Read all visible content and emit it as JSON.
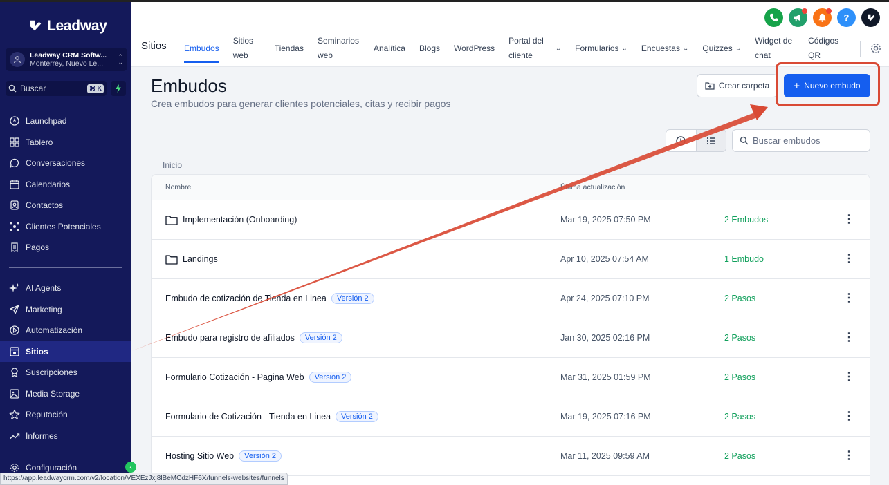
{
  "brand": {
    "name": "Leadway"
  },
  "account": {
    "name": "Leadway CRM Softw...",
    "location": "Monterrey, Nuevo Le..."
  },
  "sidebar": {
    "search_label": "Buscar",
    "search_shortcut": "⌘ K",
    "items": [
      {
        "label": "Launchpad",
        "icon": "rocket-icon"
      },
      {
        "label": "Tablero",
        "icon": "grid-icon"
      },
      {
        "label": "Conversaciones",
        "icon": "chat-icon"
      },
      {
        "label": "Calendarios",
        "icon": "calendar-icon"
      },
      {
        "label": "Contactos",
        "icon": "contacts-icon"
      },
      {
        "label": "Clientes Potenciales",
        "icon": "leads-icon"
      },
      {
        "label": "Pagos",
        "icon": "receipt-icon"
      }
    ],
    "items2": [
      {
        "label": "AI Agents",
        "icon": "sparkle-icon"
      },
      {
        "label": "Marketing",
        "icon": "send-icon"
      },
      {
        "label": "Automatización",
        "icon": "automation-icon"
      },
      {
        "label": "Sitios",
        "icon": "site-icon",
        "active": true
      },
      {
        "label": "Suscripciones",
        "icon": "badge-icon"
      },
      {
        "label": "Media Storage",
        "icon": "image-icon"
      },
      {
        "label": "Reputación",
        "icon": "star-icon"
      },
      {
        "label": "Informes",
        "icon": "trend-icon"
      }
    ],
    "settings_label": "Configuración"
  },
  "status_url": "https://app.leadwaycrm.com/v2/location/VEXEzJxj8lBeMCdzHF6X/funnels-websites/funnels",
  "topbar": {
    "section_title": "Sitios",
    "tabs": [
      {
        "label": "Embudos",
        "active": true
      },
      {
        "label": "Sitios web"
      },
      {
        "label": "Tiendas"
      },
      {
        "label": "Seminarios web"
      },
      {
        "label": "Analítica"
      },
      {
        "label": "Blogs"
      },
      {
        "label": "WordPress"
      },
      {
        "label": "Portal del cliente",
        "dropdown": true
      },
      {
        "label": "Formularios",
        "dropdown": true
      },
      {
        "label": "Encuestas",
        "dropdown": true
      },
      {
        "label": "Quizzes",
        "dropdown": true
      },
      {
        "label": "Widget de chat"
      },
      {
        "label": "Códigos QR"
      }
    ],
    "icons": [
      {
        "name": "phone-icon",
        "color": "#16a34a"
      },
      {
        "name": "megaphone-icon",
        "color": "#22a06b"
      },
      {
        "name": "bell-icon",
        "color": "#f97316"
      },
      {
        "name": "help-icon",
        "color": "#2e90fa",
        "glyph": "?"
      },
      {
        "name": "brand-icon",
        "color": "#101828"
      }
    ]
  },
  "main": {
    "title": "Embudos",
    "subtitle": "Crea embudos para generar clientes potenciales, citas y recibir pagos",
    "create_folder_label": "Crear carpeta",
    "new_funnel_label": "Nuevo embudo",
    "search_placeholder": "Buscar embudos",
    "breadcrumb": "Inicio",
    "columns": {
      "name": "Nombre",
      "updated": "Última actualización"
    },
    "rows": [
      {
        "name": "Implementación (Onboarding)",
        "folder": true,
        "date": "Mar 19, 2025 07:50 PM",
        "count": "2 Embudos"
      },
      {
        "name": "Landings",
        "folder": true,
        "date": "Apr 10, 2025 07:54 AM",
        "count": "1 Embudo"
      },
      {
        "name": "Embudo de cotización de Tienda en Linea",
        "badge": "Versión 2",
        "date": "Apr 24, 2025 07:10 PM",
        "count": "2 Pasos"
      },
      {
        "name": "Embudo para registro de afiliados",
        "badge": "Versión 2",
        "date": "Jan 30, 2025 02:16 PM",
        "count": "2 Pasos"
      },
      {
        "name": "Formulario Cotización - Pagina Web",
        "badge": "Versión 2",
        "date": "Mar 31, 2025 01:59 PM",
        "count": "2 Pasos"
      },
      {
        "name": "Formulario de Cotización - Tienda en Linea",
        "badge": "Versión 2",
        "date": "Mar 19, 2025 07:16 PM",
        "count": "2 Pasos"
      },
      {
        "name": "Hosting Sitio Web",
        "badge": "Versión 2",
        "date": "Mar 11, 2025 09:59 AM",
        "count": "2 Pasos"
      }
    ]
  },
  "annotation": {
    "color": "#d94a35"
  }
}
